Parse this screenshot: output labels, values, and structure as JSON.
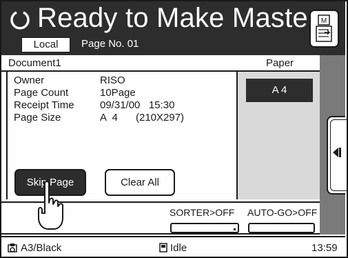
{
  "header": {
    "title": "Ready to Make Master",
    "mode_chip": "Local",
    "page_no": "Page No. 01"
  },
  "document": {
    "name": "Document1",
    "paper_header": "Paper"
  },
  "info": [
    {
      "label": "Owner",
      "value": "RISO"
    },
    {
      "label": "Page Count",
      "value": "10Page"
    },
    {
      "label": "Receipt Time",
      "value": "09/31/00   15:30"
    },
    {
      "label": "Page Size",
      "value_a": "A  4",
      "value_b": "(210X297)"
    }
  ],
  "buttons": {
    "skip_page": "Skip Page",
    "clear_all": "Clear All"
  },
  "paper": {
    "size": "A 4"
  },
  "options": {
    "sorter": "SORTER>OFF",
    "auto_go": "AUTO-GO>OFF"
  },
  "status_bar": {
    "ink": "A3/Black",
    "state": "Idle",
    "time": "13:59"
  },
  "colors": {
    "dark": "#2d2d2d",
    "panel_gray": "#d9d9d9",
    "strip_gray": "#7a7a7a"
  }
}
